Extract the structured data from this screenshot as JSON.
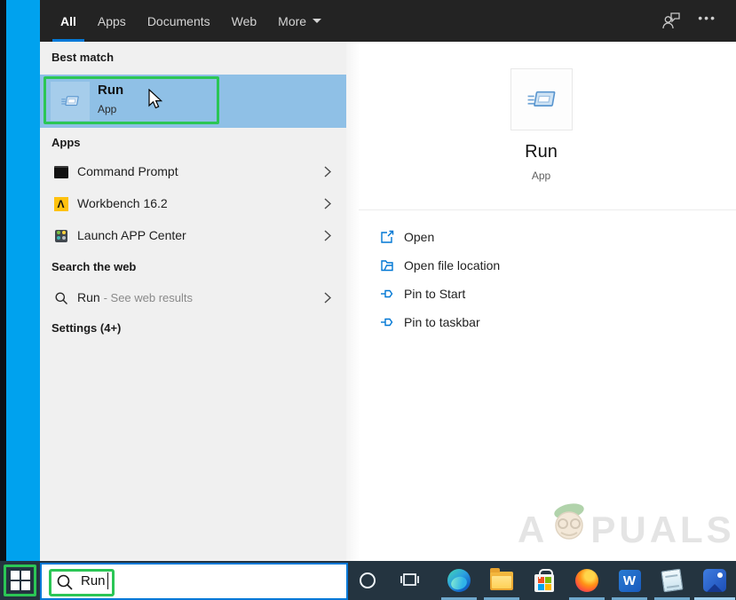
{
  "topbar": {
    "tabs": [
      {
        "label": "All",
        "active": true
      },
      {
        "label": "Apps",
        "active": false
      },
      {
        "label": "Documents",
        "active": false
      },
      {
        "label": "Web",
        "active": false
      },
      {
        "label": "More",
        "active": false
      }
    ],
    "overflow_dots": "•••"
  },
  "search_panel": {
    "best_match_header": "Best match",
    "best_match": {
      "title": "Run",
      "type": "App"
    },
    "apps_header": "Apps",
    "apps": [
      {
        "label": "Command Prompt"
      },
      {
        "label": "Workbench 16.2"
      },
      {
        "label": "Launch APP Center"
      }
    ],
    "search_web_header": "Search the web",
    "search_web_item": {
      "query": "Run",
      "suffix": "- See web results"
    },
    "settings_header": "Settings (4+)"
  },
  "detail_panel": {
    "app_name": "Run",
    "app_type": "App",
    "actions": [
      {
        "label": "Open",
        "icon": "open-icon"
      },
      {
        "label": "Open file location",
        "icon": "folder-icon"
      },
      {
        "label": "Pin to Start",
        "icon": "pin-icon"
      },
      {
        "label": "Pin to taskbar",
        "icon": "pin-icon"
      }
    ]
  },
  "taskbar": {
    "search_value": "Run",
    "icons": [
      "start",
      "search-box",
      "cortana",
      "task-view",
      "edge",
      "file-explorer",
      "microsoft-store",
      "firefox",
      "word",
      "notepad",
      "photos"
    ],
    "running_indicator_icons": [
      "edge",
      "file-explorer",
      "firefox",
      "word",
      "notepad",
      "photos"
    ]
  },
  "icon_glyphs": {
    "workbench": "Λ",
    "word": "W"
  },
  "watermark": {
    "prefix": "A",
    "suffix": "PUALS"
  },
  "colors": {
    "accent": "#0078d7",
    "selection": "#8fc0e6",
    "annotation_green": "#2bc655",
    "desktop": "#00a2ee",
    "taskbar": "#243440",
    "topbar": "#232323",
    "panel": "#f0f0f0"
  }
}
